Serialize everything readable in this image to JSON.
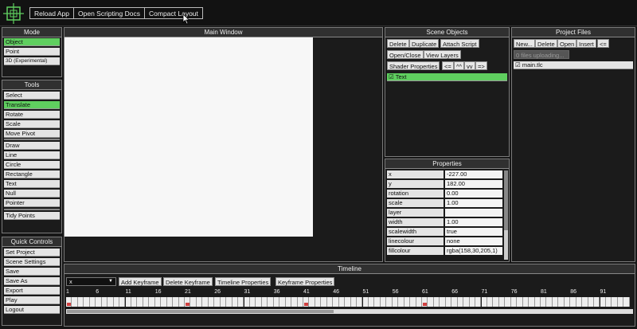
{
  "toolbar": {
    "reload": "Reload App",
    "docs": "Open Scripting Docs",
    "compact": "Compact Layout"
  },
  "mode": {
    "title": "Mode",
    "items": [
      "Object",
      "Point",
      "3D (Experimental)"
    ]
  },
  "tools": {
    "title": "Tools",
    "group1": [
      "Select",
      "Translate",
      "Rotate",
      "Scale",
      "Move Pivot"
    ],
    "group2": [
      "Draw",
      "Line",
      "Circle",
      "Rectangle",
      "Text",
      "Null",
      "Pointer"
    ],
    "group3": [
      "Tidy Points"
    ]
  },
  "quick": {
    "title": "Quick Controls",
    "items": [
      "Set Project",
      "Scene Settings",
      "Save",
      "Save As",
      "Export",
      "Play",
      "Logout"
    ]
  },
  "main": {
    "title": "Main Window"
  },
  "scene": {
    "title": "Scene Objects",
    "delete": "Delete",
    "duplicate": "Duplicate",
    "attach": "Attach Script",
    "openclose": "Open/Close",
    "viewlayers": "View Layers",
    "shader": "Shader Properties",
    "left": "<=",
    "up": "^^",
    "down": "vv",
    "right": "=>",
    "object": "Text"
  },
  "files": {
    "title": "Project Files",
    "new": "New...",
    "delete": "Delete",
    "open": "Open",
    "insert": "Insert",
    "back": "<=",
    "uploading": "0 files uploading...",
    "file": "main.tlc"
  },
  "props": {
    "title": "Properties",
    "rows": [
      {
        "k": "x",
        "v": "-227.00"
      },
      {
        "k": "y",
        "v": "182.00"
      },
      {
        "k": "rotation",
        "v": "0.00"
      },
      {
        "k": "scale",
        "v": "1.00"
      },
      {
        "k": "layer",
        "v": ""
      },
      {
        "k": "width",
        "v": "1.00"
      },
      {
        "k": "scalewidth",
        "v": "true"
      },
      {
        "k": "linecolour",
        "v": "none"
      },
      {
        "k": "fillcolour",
        "v": "rgba(158,30,205,1)"
      }
    ]
  },
  "timeline": {
    "title": "Timeline",
    "select": "x",
    "addkey": "Add Keyframe",
    "delkey": "Delete Keyframe",
    "tlprops": "Timeline Properties",
    "kfprops": "Keyframe Properties",
    "ticks": [
      "1",
      "6",
      "11",
      "16",
      "21",
      "26",
      "31",
      "36",
      "41",
      "46",
      "51",
      "56",
      "61",
      "66",
      "71",
      "76",
      "81",
      "86",
      "91"
    ],
    "keyframes": [
      1,
      21,
      41,
      61
    ]
  },
  "colors": {
    "accent": "#5fcf5f",
    "keyframe": "#d04040"
  }
}
